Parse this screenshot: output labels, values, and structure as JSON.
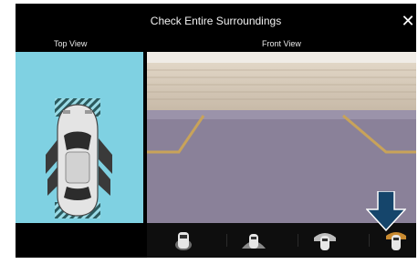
{
  "screen": {
    "title": "Check Entire Surroundings",
    "close_label": "✕",
    "top_view_label": "Top View",
    "front_view_label": "Front View"
  },
  "camera_buttons": [
    {
      "name": "rear-view",
      "selected": false
    },
    {
      "name": "front-wide",
      "selected": false
    },
    {
      "name": "front-top",
      "selected": false
    },
    {
      "name": "rear-top",
      "selected": true
    }
  ],
  "colors": {
    "accent_pointer": "#15456b",
    "top_view_bg": "#7fd1e2",
    "parking_lines": "#c8a35a",
    "selected_zone": "#c98a30"
  },
  "icons": {
    "close": "close-icon",
    "pointer": "down-arrow-icon"
  }
}
